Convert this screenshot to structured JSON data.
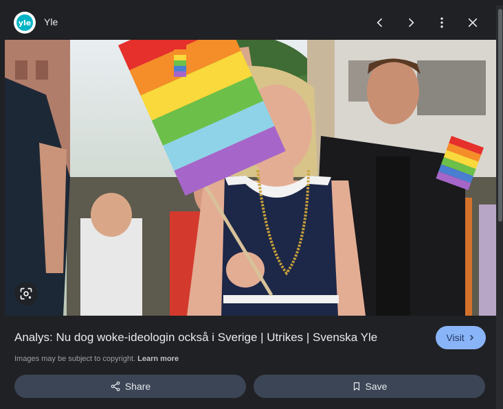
{
  "header": {
    "source_logo_text": "yle",
    "source_name": "Yle",
    "icons": [
      "chevron-left-icon",
      "chevron-right-icon",
      "more-vert-icon",
      "close-icon"
    ]
  },
  "image": {
    "lens_icon": "lens-icon"
  },
  "result": {
    "title": "Analys: Nu dog woke-ideologin också i Sverige | Utrikes | Svenska Yle",
    "visit_label": "Visit",
    "copyright_text": "Images may be subject to copyright.",
    "learn_more_label": "Learn more"
  },
  "actions": {
    "share_label": "Share",
    "save_label": "Save"
  },
  "colors": {
    "background": "#202124",
    "visit_button": "#8ab4f8",
    "action_button": "#3c4556",
    "logo_accent": "#00b4c5"
  }
}
